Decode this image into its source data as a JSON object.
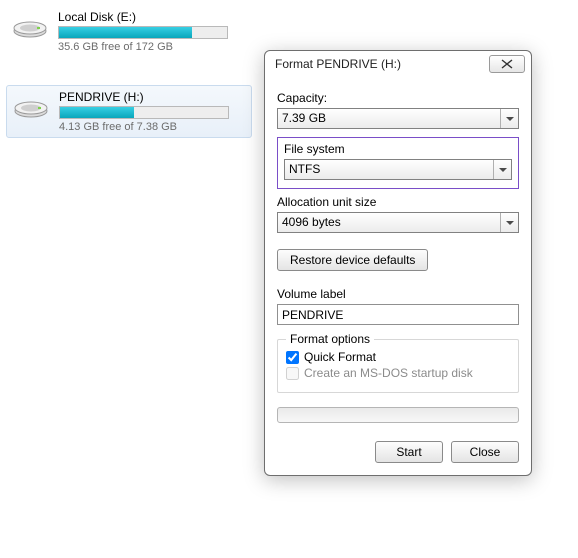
{
  "drives": [
    {
      "name": "Local Disk (E:)",
      "free_text": "35.6 GB free of 172 GB",
      "fill_pct": 79
    },
    {
      "name": "PENDRIVE (H:)",
      "free_text": "4.13 GB free of 7.38 GB",
      "fill_pct": 44,
      "selected": true
    }
  ],
  "dialog": {
    "title": "Format PENDRIVE (H:)",
    "capacity_label": "Capacity:",
    "capacity_value": "7.39 GB",
    "fs_label": "File system",
    "fs_value": "NTFS",
    "aus_label": "Allocation unit size",
    "aus_value": "4096 bytes",
    "restore_label": "Restore device defaults",
    "vol_label": "Volume label",
    "vol_value": "PENDRIVE",
    "opts_legend": "Format options",
    "quick_label": "Quick Format",
    "quick_checked": true,
    "msdos_label": "Create an MS-DOS startup disk",
    "msdos_checked": false,
    "start_label": "Start",
    "close_label": "Close"
  }
}
